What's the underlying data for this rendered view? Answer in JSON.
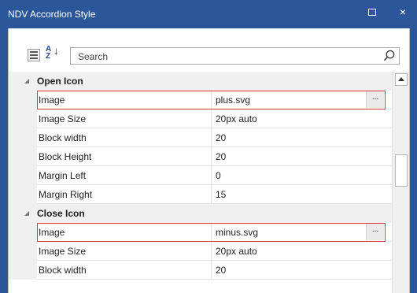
{
  "window": {
    "title": "NDV Accordion Style",
    "maximize_glyph": "",
    "close_glyph": "×"
  },
  "toolbar": {
    "categorized_icon": "categorized-view-icon",
    "alphabetical_icon": "sort-alphabetical-icon",
    "sort_letters_top": "A",
    "sort_letters_bottom": "Z",
    "search_placeholder": "Search",
    "search_icon": "search-icon"
  },
  "grid": {
    "open_icon": {
      "label": "Open Icon",
      "rows": [
        {
          "name": "Image",
          "value": "plus.svg",
          "has_ellipsis": true,
          "highlighted": true
        },
        {
          "name": "Image Size",
          "value": "20px auto"
        },
        {
          "name": "Block width",
          "value": "20"
        },
        {
          "name": "Block Height",
          "value": "20"
        },
        {
          "name": "Margin Left",
          "value": "0"
        },
        {
          "name": "Margin Right",
          "value": "15"
        }
      ]
    },
    "close_icon": {
      "label": "Close Icon",
      "rows": [
        {
          "name": "Image",
          "value": "minus.svg",
          "has_ellipsis": true,
          "highlighted": true
        },
        {
          "name": "Image Size",
          "value": "20px auto"
        },
        {
          "name": "Block width",
          "value": "20"
        }
      ]
    },
    "ellipsis_label": "...",
    "collapse_glyph": "◢"
  },
  "colors": {
    "titlebar": "#2b579a",
    "highlight": "#d9364a",
    "category_bg": "#f0f0f0"
  }
}
